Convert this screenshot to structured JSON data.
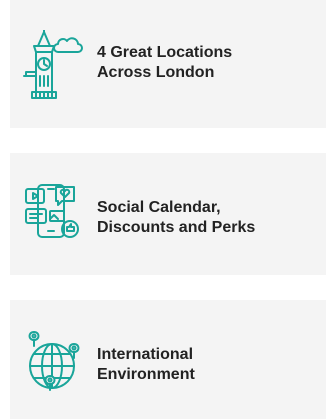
{
  "colors": {
    "accent": "#1aa59a",
    "card_bg": "#f4f4f4",
    "text": "#222222"
  },
  "features": [
    {
      "icon": "big-ben-clock-icon",
      "line1": "4 Great Locations",
      "line2": "Across London"
    },
    {
      "icon": "social-phone-icon",
      "line1": "Social Calendar,",
      "line2": "Discounts and Perks"
    },
    {
      "icon": "globe-pins-icon",
      "line1": "International",
      "line2": "Environment"
    }
  ]
}
